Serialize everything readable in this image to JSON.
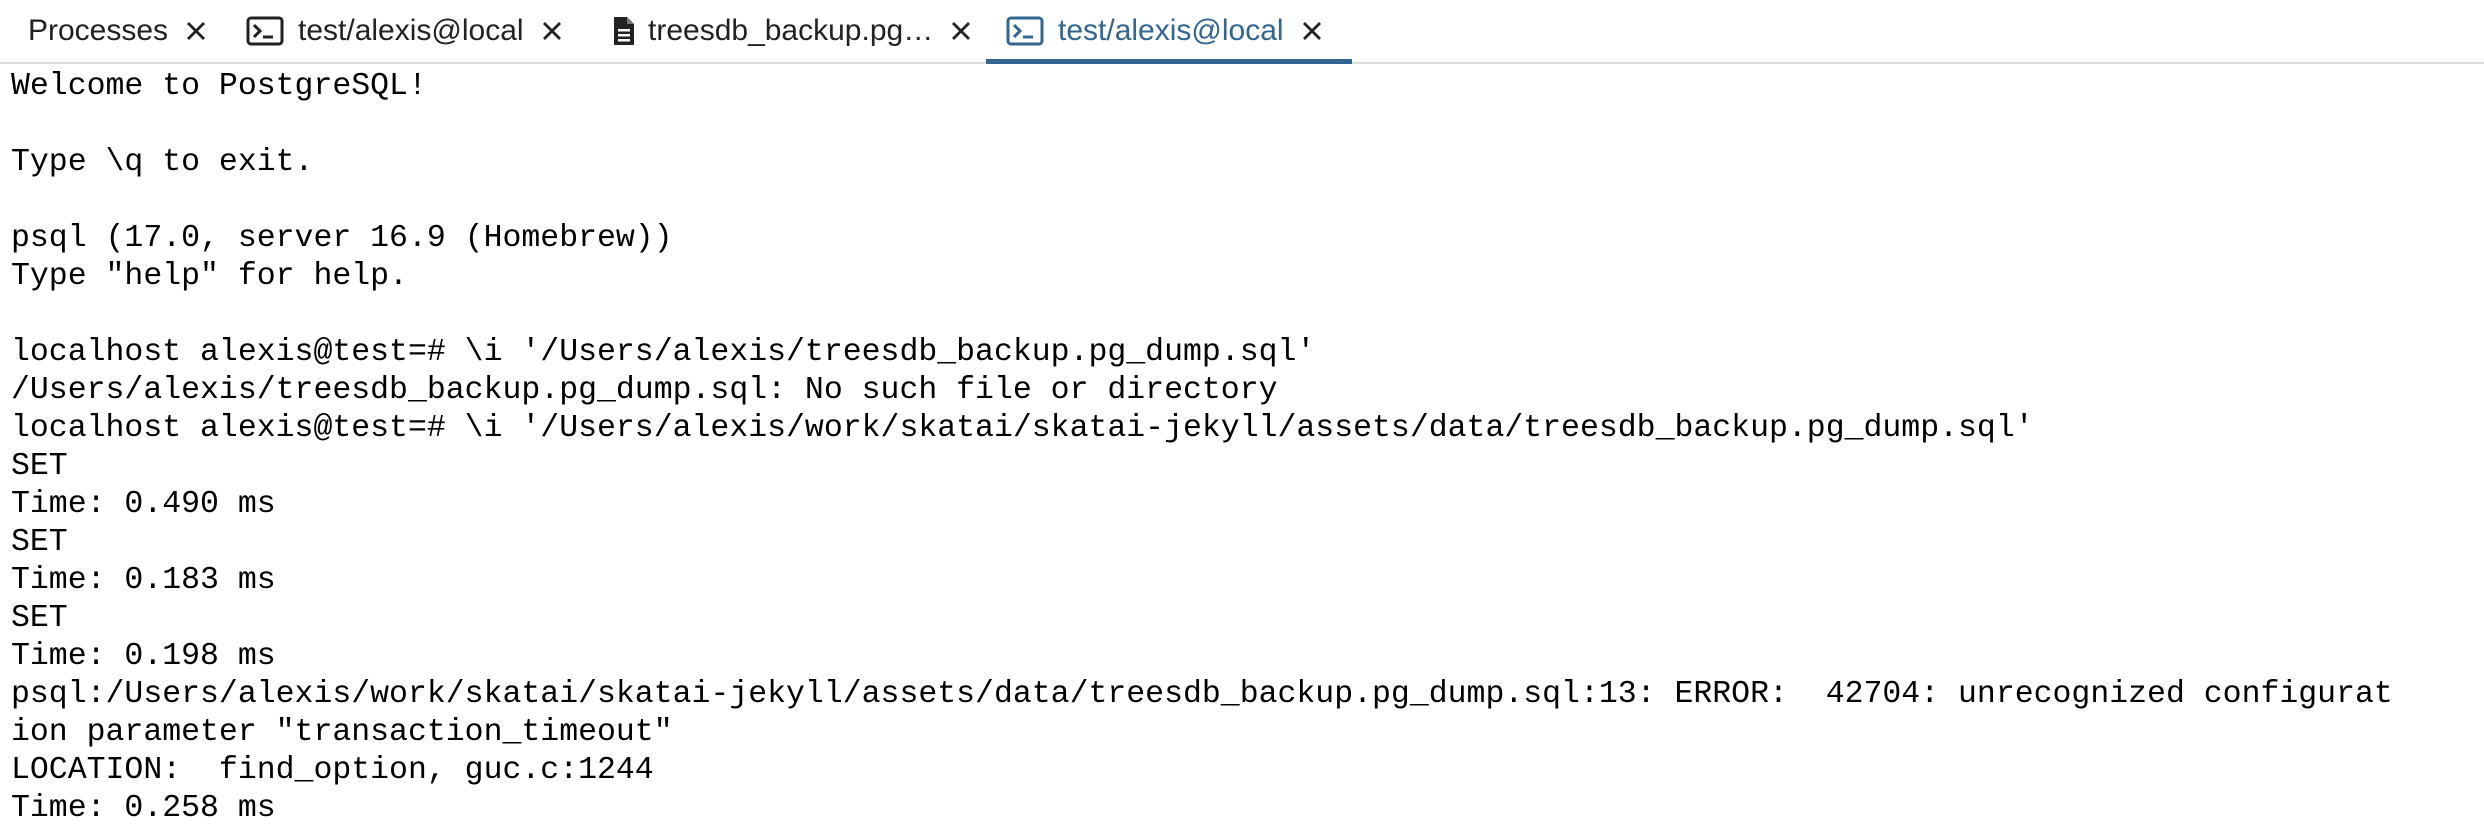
{
  "tabs": [
    {
      "label": "Processes",
      "icon": "none",
      "active": false
    },
    {
      "label": "test/alexis@local",
      "icon": "terminal-icon",
      "active": false
    },
    {
      "label": "treesdb_backup.pg…",
      "icon": "document-icon",
      "active": false
    },
    {
      "label": "test/alexis@local",
      "icon": "terminal-icon",
      "active": true
    }
  ],
  "colors": {
    "accent": "#326690",
    "text": "#222222",
    "terminal_text": "#000000"
  },
  "terminal": {
    "lines": [
      "Welcome to PostgreSQL!",
      "",
      "Type \\q to exit.",
      "",
      "psql (17.0, server 16.9 (Homebrew))",
      "Type \"help\" for help.",
      "",
      "localhost alexis@test=# \\i '/Users/alexis/treesdb_backup.pg_dump.sql'",
      "/Users/alexis/treesdb_backup.pg_dump.sql: No such file or directory",
      "localhost alexis@test=# \\i '/Users/alexis/work/skatai/skatai-jekyll/assets/data/treesdb_backup.pg_dump.sql'",
      "SET",
      "Time: 0.490 ms",
      "SET",
      "Time: 0.183 ms",
      "SET",
      "Time: 0.198 ms",
      "psql:/Users/alexis/work/skatai/skatai-jekyll/assets/data/treesdb_backup.pg_dump.sql:13: ERROR:  42704: unrecognized configurat",
      "ion parameter \"transaction_timeout\"",
      "LOCATION:  find_option, guc.c:1244",
      "Time: 0.258 ms"
    ]
  }
}
